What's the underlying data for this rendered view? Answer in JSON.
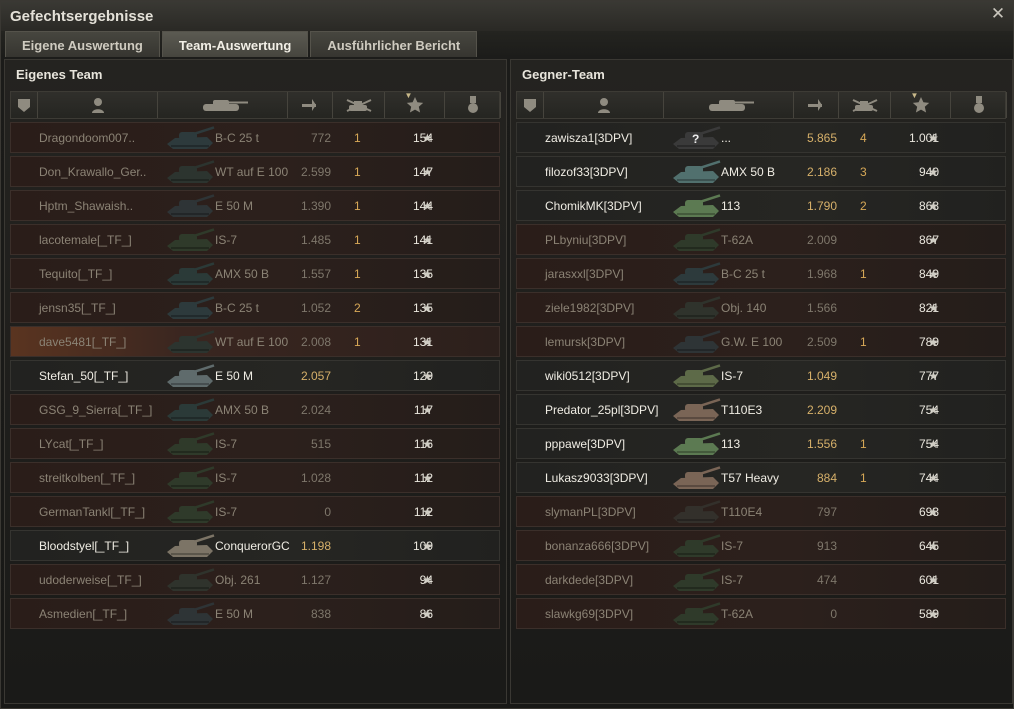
{
  "window": {
    "title": "Gefechtsergebnisse"
  },
  "tabs": [
    {
      "label": "Eigene Auswertung",
      "active": false
    },
    {
      "label": "Team-Auswertung",
      "active": true
    },
    {
      "label": "Ausführlicher Bericht",
      "active": false
    }
  ],
  "header_icons": [
    "platoon-icon",
    "player-icon",
    "vehicle-icon",
    "damage-icon",
    "kills-icon",
    "experience-star-icon",
    "medal-icon"
  ],
  "colors": {
    "accent": "#d7a857",
    "dead_row": "#2c201c",
    "alive_row": "#262623"
  },
  "left": {
    "title": "Eigenes Team",
    "rows": [
      {
        "name": "Dragondoom007..",
        "tank": "B-C 25 t",
        "damage": "772",
        "kills": "1",
        "xp": "154",
        "alive": false,
        "tank_color": "#2d3a3c"
      },
      {
        "name": "Don_Krawallo_Ger..",
        "tank": "WT auf E 100",
        "damage": "2.599",
        "kills": "1",
        "xp": "147",
        "alive": false,
        "tank_color": "#2c342f"
      },
      {
        "name": "Hptm_Shawaish..",
        "tank": "E 50 M",
        "damage": "1.390",
        "kills": "1",
        "xp": "144",
        "alive": false,
        "tank_color": "#2e3436"
      },
      {
        "name": "lacotemale[_TF_]",
        "tank": "IS-7",
        "damage": "1.485",
        "kills": "1",
        "xp": "141",
        "alive": false,
        "tank_color": "#2f3a2a"
      },
      {
        "name": "Tequito[_TF_]",
        "tank": "AMX 50 B",
        "damage": "1.557",
        "kills": "1",
        "xp": "135",
        "alive": false,
        "tank_color": "#2b3a38"
      },
      {
        "name": "jensn35[_TF_]",
        "tank": "B-C 25 t",
        "damage": "1.052",
        "kills": "2",
        "xp": "135",
        "alive": false,
        "tank_color": "#2d3a3c"
      },
      {
        "name": "dave5481[_TF_]",
        "tank": "WT auf E 100",
        "damage": "2.008",
        "kills": "1",
        "xp": "131",
        "alive": false,
        "highlight": true,
        "tank_color": "#2c342f"
      },
      {
        "name": "Stefan_50[_TF_]",
        "tank": "E 50 M",
        "damage": "2.057",
        "kills": "",
        "xp": "129",
        "alive": true,
        "tank_color": "#5f6b6c"
      },
      {
        "name": "GSG_9_Sierra[_TF_]",
        "tank": "AMX 50 B",
        "damage": "2.024",
        "kills": "",
        "xp": "117",
        "alive": false,
        "tank_color": "#2b3a38"
      },
      {
        "name": "LYcat[_TF_]",
        "tank": "IS-7",
        "damage": "515",
        "kills": "",
        "xp": "116",
        "alive": false,
        "tank_color": "#2f3a2a"
      },
      {
        "name": "streitkolben[_TF_]",
        "tank": "IS-7",
        "damage": "1.028",
        "kills": "",
        "xp": "112",
        "alive": false,
        "tank_color": "#2f3a2a"
      },
      {
        "name": "GermanTankl[_TF_]",
        "tank": "IS-7",
        "damage": "0",
        "kills": "",
        "xp": "112",
        "alive": false,
        "tank_color": "#2f3a2a"
      },
      {
        "name": "Bloodstyel[_TF_]",
        "tank": "ConquerorGC",
        "damage": "1.198",
        "kills": "",
        "xp": "109",
        "alive": true,
        "tank_color": "#7c7466"
      },
      {
        "name": "udoderweise[_TF_]",
        "tank": "Obj. 261",
        "damage": "1.127",
        "kills": "",
        "xp": "94",
        "alive": false,
        "tank_color": "#2f332c"
      },
      {
        "name": "Asmedien[_TF_]",
        "tank": "E 50 M",
        "damage": "838",
        "kills": "",
        "xp": "86",
        "alive": false,
        "tank_color": "#2e3436"
      }
    ]
  },
  "right": {
    "title": "Gegner-Team",
    "rows": [
      {
        "name": "zawisza1[3DPV]",
        "tank": "...",
        "damage": "5.865",
        "kills": "4",
        "xp": "1.001",
        "alive": true,
        "unknown": true,
        "unknown_label": "?",
        "tank_color": "#3a3a3a"
      },
      {
        "name": "filozof33[3DPV]",
        "tank": "AMX 50 B",
        "damage": "2.186",
        "kills": "3",
        "xp": "940",
        "alive": true,
        "tank_color": "#51706e"
      },
      {
        "name": "ChomikMK[3DPV]",
        "tank": "113",
        "damage": "1.790",
        "kills": "2",
        "xp": "868",
        "alive": true,
        "tank_color": "#5c7a52"
      },
      {
        "name": "PLbyniu[3DPV]",
        "tank": "T-62A",
        "damage": "2.009",
        "kills": "",
        "xp": "867",
        "alive": false,
        "tank_color": "#2f3a2a"
      },
      {
        "name": "jarasxxl[3DPV]",
        "tank": "B-C 25 t",
        "damage": "1.968",
        "kills": "1",
        "xp": "849",
        "alive": false,
        "tank_color": "#2d3a3c"
      },
      {
        "name": "ziele1982[3DPV]",
        "tank": "Obj. 140",
        "damage": "1.566",
        "kills": "",
        "xp": "821",
        "alive": false,
        "tank_color": "#2f332c"
      },
      {
        "name": "lemursk[3DPV]",
        "tank": "G.W. E 100",
        "damage": "2.509",
        "kills": "1",
        "xp": "789",
        "alive": false,
        "tank_color": "#2e3436"
      },
      {
        "name": "wiki0512[3DPV]",
        "tank": "IS-7",
        "damage": "1.049",
        "kills": "",
        "xp": "777",
        "alive": true,
        "tank_color": "#5d6a48"
      },
      {
        "name": "Predator_25pl[3DPV]",
        "tank": "T110E3",
        "damage": "2.209",
        "kills": "",
        "xp": "754",
        "alive": true,
        "tank_color": "#7a6556"
      },
      {
        "name": "pppawe[3DPV]",
        "tank": "113",
        "damage": "1.556",
        "kills": "1",
        "xp": "754",
        "alive": true,
        "tank_color": "#5c7a52"
      },
      {
        "name": "Lukasz9033[3DPV]",
        "tank": "T57 Heavy",
        "damage": "884",
        "kills": "1",
        "xp": "744",
        "alive": true,
        "tank_color": "#7a6556"
      },
      {
        "name": "slymanPL[3DPV]",
        "tank": "T110E4",
        "damage": "797",
        "kills": "",
        "xp": "693",
        "alive": false,
        "tank_color": "#33302b"
      },
      {
        "name": "bonanza666[3DPV]",
        "tank": "IS-7",
        "damage": "913",
        "kills": "",
        "xp": "645",
        "alive": false,
        "tank_color": "#2f3a2a"
      },
      {
        "name": "darkdede[3DPV]",
        "tank": "IS-7",
        "damage": "474",
        "kills": "",
        "xp": "601",
        "alive": false,
        "tank_color": "#2f3a2a"
      },
      {
        "name": "slawkg69[3DPV]",
        "tank": "T-62A",
        "damage": "0",
        "kills": "",
        "xp": "589",
        "alive": false,
        "tank_color": "#2f3a2a"
      }
    ]
  }
}
